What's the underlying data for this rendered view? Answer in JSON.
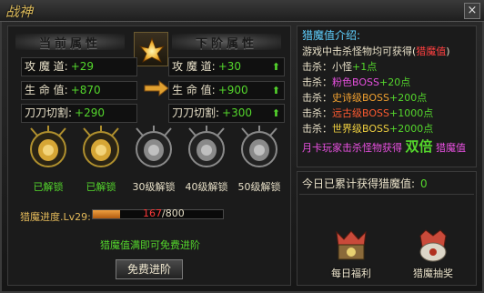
{
  "window": {
    "logo_text": "战神",
    "close": "×"
  },
  "left": {
    "current_title": "当前属性",
    "next_title": "下阶属性",
    "stats": [
      {
        "label": "攻 魔 道:",
        "current": "+29",
        "next": "+30"
      },
      {
        "label": "生 命 值:",
        "current": "+870",
        "next": "+900"
      },
      {
        "label": "刀刀切割:",
        "current": "+290",
        "next": "+300"
      }
    ],
    "up_glyph": "⬆",
    "slots": [
      {
        "label": "已解锁",
        "unlocked": true
      },
      {
        "label": "已解锁",
        "unlocked": true
      },
      {
        "label": "30级解锁",
        "unlocked": false
      },
      {
        "label": "40级解锁",
        "unlocked": false
      },
      {
        "label": "50级解锁",
        "unlocked": false
      }
    ],
    "progress": {
      "label": "猎魔进度.Lv29:",
      "current": 167,
      "max": 800,
      "current_text": "167",
      "max_text": "/800"
    },
    "tip": "猎魔值满即可免费进阶",
    "advance_button": "免费进阶"
  },
  "intro": {
    "title": "猎魔值介绍:",
    "line1_a": "游戏中击杀怪物均可获得(",
    "line1_b": "猎魔值",
    "line1_c": ")",
    "kills": [
      {
        "prefix": "击杀：",
        "target": "小怪",
        "reward": "+1点",
        "color": "w"
      },
      {
        "prefix": "击杀：",
        "target": "粉色BOSS",
        "reward": "+20点",
        "color": "pink"
      },
      {
        "prefix": "击杀：",
        "target": "史诗级BOSS",
        "reward": "+200点",
        "color": "orange"
      },
      {
        "prefix": "击杀：",
        "target": "远古级BOSS",
        "reward": "+1000点",
        "color": "orred"
      },
      {
        "prefix": "击杀：",
        "target": "世界级BOSS",
        "reward": "+2000点",
        "color": "gold"
      }
    ],
    "monthly_a": "月卡玩家击杀怪物获得",
    "monthly_big": "双倍",
    "monthly_b": "猎魔值"
  },
  "today": {
    "label": "今日已累计获得猎魔值:",
    "value": "0",
    "daily_welfare": "每日福利",
    "lottery": "猎魔抽奖"
  },
  "colors": {
    "green": "#54d62c",
    "gold": "#e3b95a",
    "red": "#ff3a3a",
    "cyan": "#5fd0ff"
  }
}
